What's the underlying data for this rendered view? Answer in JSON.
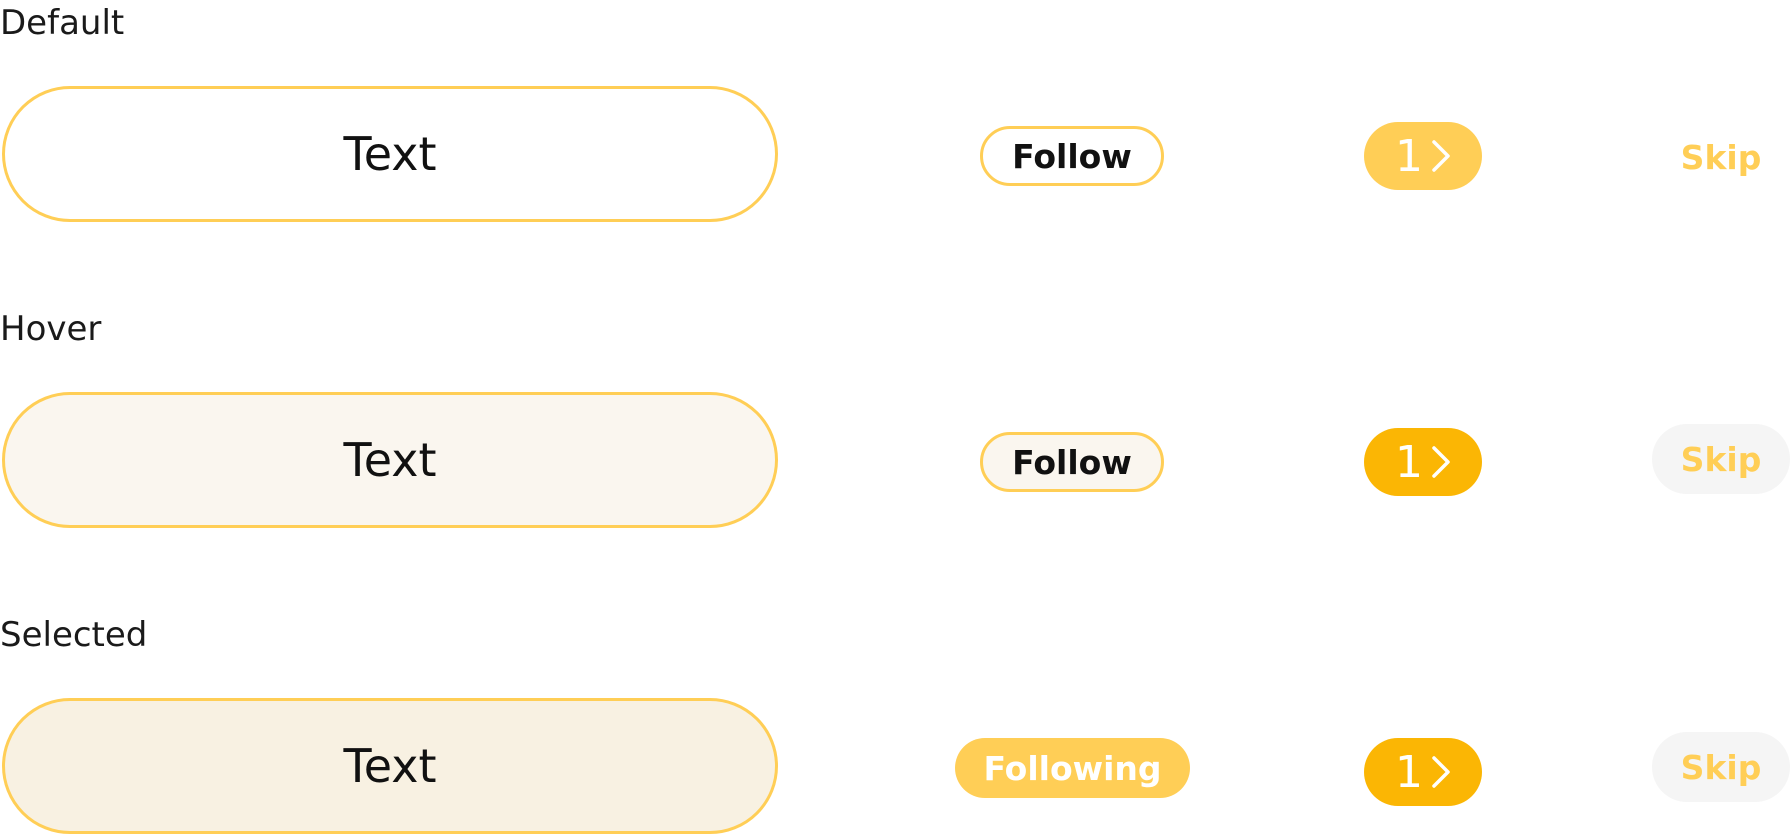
{
  "colors": {
    "accent_light": "#FFCE56",
    "accent_strong": "#FBB604",
    "hover_bg": "#FAF6EF",
    "selected_bg": "#F8F1E2",
    "skip_hover_bg": "#F5F5F5"
  },
  "rows": [
    {
      "state": "Default",
      "text_button": "Text",
      "follow_button": "Follow",
      "count_button": {
        "count": "1",
        "icon": "chevron-right-icon"
      },
      "skip_button": "Skip"
    },
    {
      "state": "Hover",
      "text_button": "Text",
      "follow_button": "Follow",
      "count_button": {
        "count": "1",
        "icon": "chevron-right-icon"
      },
      "skip_button": "Skip"
    },
    {
      "state": "Selected",
      "text_button": "Text",
      "follow_button": "Following",
      "count_button": {
        "count": "1",
        "icon": "chevron-right-icon"
      },
      "skip_button": "Skip"
    }
  ]
}
